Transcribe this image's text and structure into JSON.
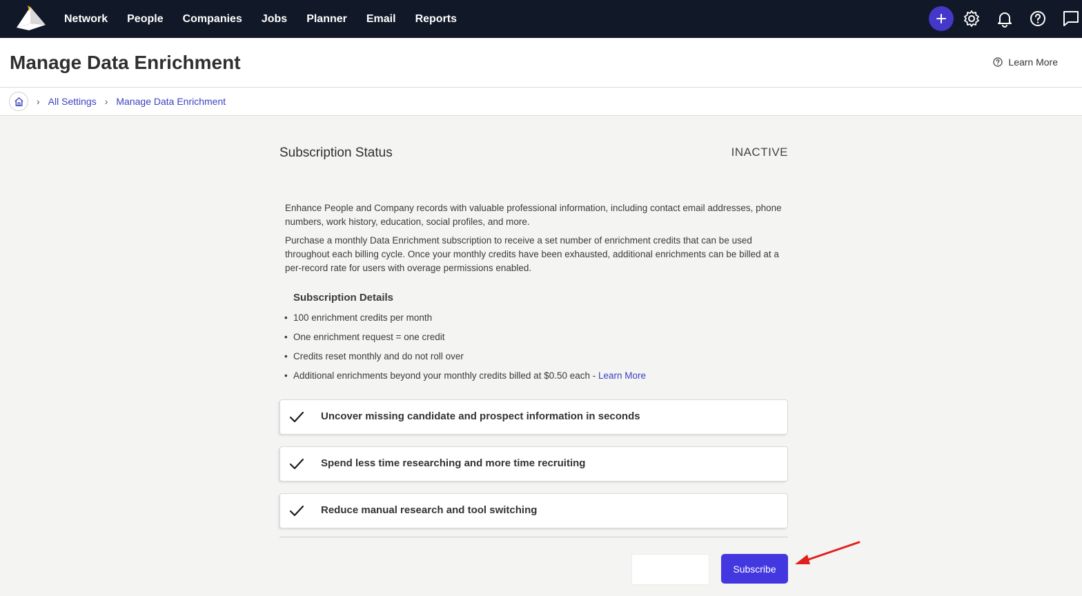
{
  "nav": {
    "items": [
      "Network",
      "People",
      "Companies",
      "Jobs",
      "Planner",
      "Email",
      "Reports"
    ],
    "icons": [
      "plus-icon",
      "gear-icon",
      "bell-icon",
      "help-icon",
      "chat-icon"
    ],
    "accent": "#4338ca",
    "background": "#111827"
  },
  "header": {
    "title": "Manage Data Enrichment",
    "learn_more": "Learn More"
  },
  "breadcrumb": {
    "items": [
      "All Settings",
      "Manage Data Enrichment"
    ]
  },
  "subscription": {
    "title": "Subscription Status",
    "status": "INACTIVE",
    "description_1": "Enhance People and Company records with valuable professional information, including contact email addresses, phone numbers, work history, education, social profiles, and more.",
    "description_2": "Purchase a monthly Data Enrichment subscription to receive a set number of enrichment credits that can be used throughout each billing cycle. Once your monthly credits have been exhausted, additional enrichments can be billed at a per-record rate for users with overage permissions enabled.",
    "details_title": "Subscription Details",
    "details": [
      "100 enrichment credits per month",
      "One enrichment request = one credit",
      "Credits reset monthly and do not roll over",
      "Additional enrichments beyond your monthly credits billed at $0.50 each - "
    ],
    "details_link": "Learn More",
    "features": [
      "Uncover missing candidate and prospect information in seconds",
      "Spend less time researching and more time recruiting",
      "Reduce manual research and tool switching"
    ],
    "subscribe_label": "Subscribe",
    "button_color": "#4338e0"
  }
}
